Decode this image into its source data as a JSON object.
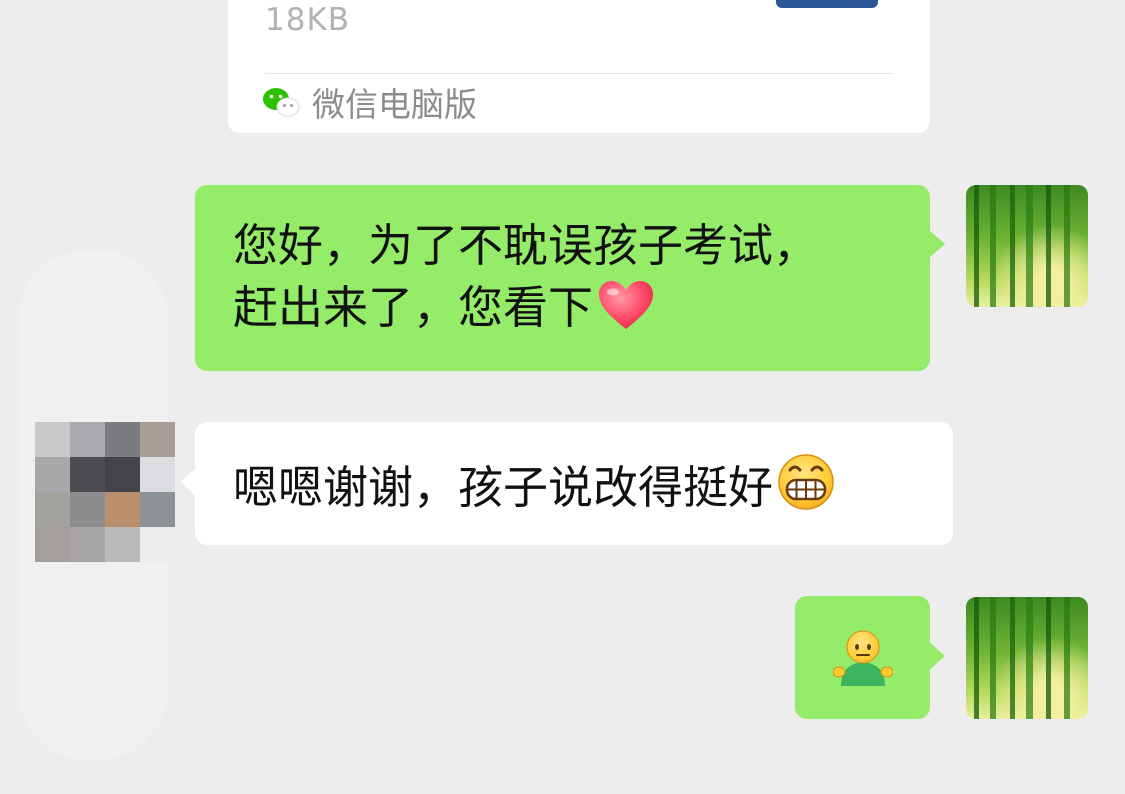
{
  "file_card": {
    "size": "18KB",
    "source_label": "微信电脑版"
  },
  "messages": [
    {
      "id": "msg1",
      "direction": "outgoing",
      "text_line1": "您好，为了不耽误孩子考试，",
      "text_line2": "赶出来了，您看下",
      "emoji": "red-heart"
    },
    {
      "id": "msg2",
      "direction": "incoming",
      "text": "嗯嗯谢谢，孩子说改得挺好",
      "emoji": "grinning-face"
    },
    {
      "id": "msg3",
      "direction": "outgoing",
      "emoji": "shrugging-person"
    }
  ],
  "avatars": {
    "self": "bamboo-forest-photo",
    "other": "pixelated-mosaic"
  },
  "colors": {
    "background": "#ededed",
    "outgoing_bubble": "#95ec69",
    "incoming_bubble": "#ffffff",
    "wechat_brand": "#2dc100",
    "message_text": "#111111",
    "muted_text": "#8c8c8c"
  }
}
